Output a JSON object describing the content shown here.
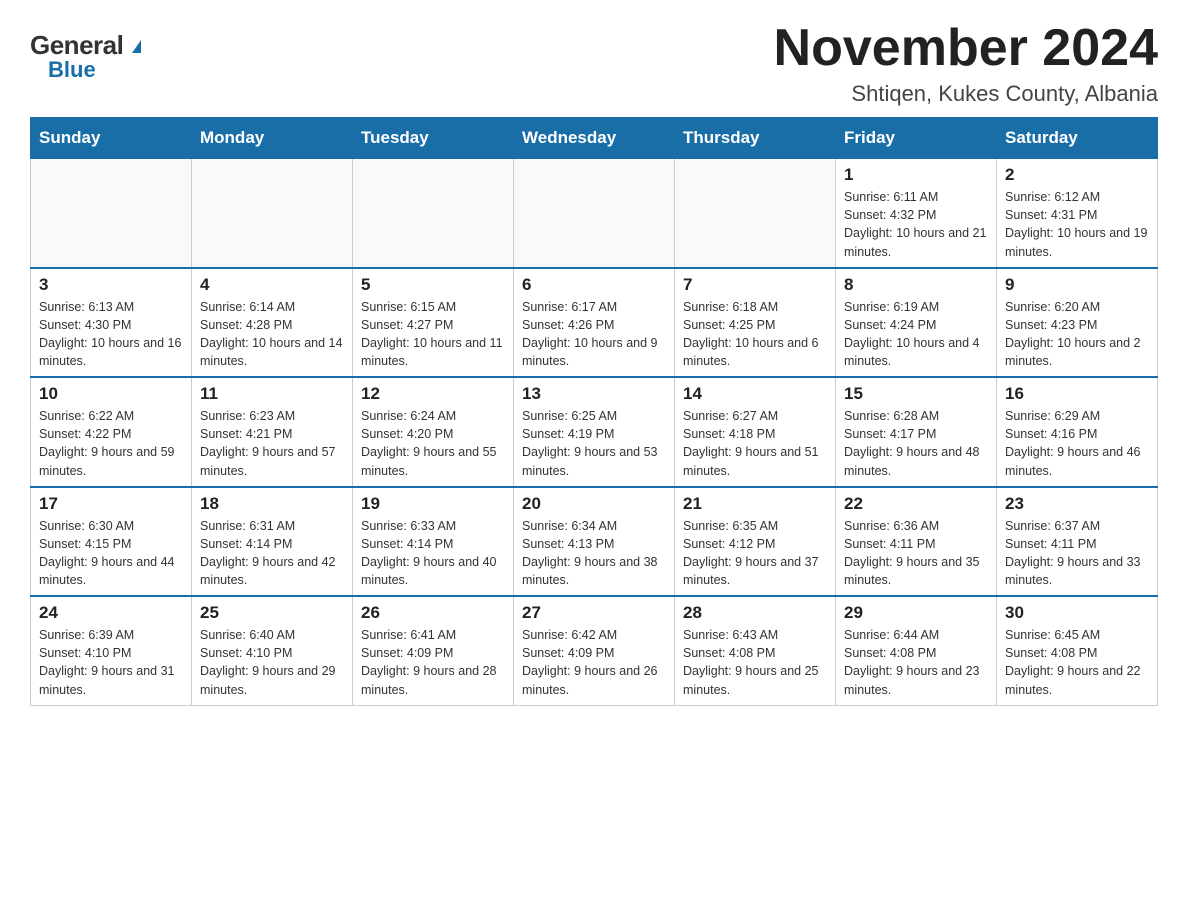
{
  "header": {
    "logo_general": "General",
    "logo_blue": "Blue",
    "title": "November 2024",
    "subtitle": "Shtiqen, Kukes County, Albania"
  },
  "weekdays": [
    "Sunday",
    "Monday",
    "Tuesday",
    "Wednesday",
    "Thursday",
    "Friday",
    "Saturday"
  ],
  "weeks": [
    [
      {
        "day": "",
        "sunrise": "",
        "sunset": "",
        "daylight": ""
      },
      {
        "day": "",
        "sunrise": "",
        "sunset": "",
        "daylight": ""
      },
      {
        "day": "",
        "sunrise": "",
        "sunset": "",
        "daylight": ""
      },
      {
        "day": "",
        "sunrise": "",
        "sunset": "",
        "daylight": ""
      },
      {
        "day": "",
        "sunrise": "",
        "sunset": "",
        "daylight": ""
      },
      {
        "day": "1",
        "sunrise": "Sunrise: 6:11 AM",
        "sunset": "Sunset: 4:32 PM",
        "daylight": "Daylight: 10 hours and 21 minutes."
      },
      {
        "day": "2",
        "sunrise": "Sunrise: 6:12 AM",
        "sunset": "Sunset: 4:31 PM",
        "daylight": "Daylight: 10 hours and 19 minutes."
      }
    ],
    [
      {
        "day": "3",
        "sunrise": "Sunrise: 6:13 AM",
        "sunset": "Sunset: 4:30 PM",
        "daylight": "Daylight: 10 hours and 16 minutes."
      },
      {
        "day": "4",
        "sunrise": "Sunrise: 6:14 AM",
        "sunset": "Sunset: 4:28 PM",
        "daylight": "Daylight: 10 hours and 14 minutes."
      },
      {
        "day": "5",
        "sunrise": "Sunrise: 6:15 AM",
        "sunset": "Sunset: 4:27 PM",
        "daylight": "Daylight: 10 hours and 11 minutes."
      },
      {
        "day": "6",
        "sunrise": "Sunrise: 6:17 AM",
        "sunset": "Sunset: 4:26 PM",
        "daylight": "Daylight: 10 hours and 9 minutes."
      },
      {
        "day": "7",
        "sunrise": "Sunrise: 6:18 AM",
        "sunset": "Sunset: 4:25 PM",
        "daylight": "Daylight: 10 hours and 6 minutes."
      },
      {
        "day": "8",
        "sunrise": "Sunrise: 6:19 AM",
        "sunset": "Sunset: 4:24 PM",
        "daylight": "Daylight: 10 hours and 4 minutes."
      },
      {
        "day": "9",
        "sunrise": "Sunrise: 6:20 AM",
        "sunset": "Sunset: 4:23 PM",
        "daylight": "Daylight: 10 hours and 2 minutes."
      }
    ],
    [
      {
        "day": "10",
        "sunrise": "Sunrise: 6:22 AM",
        "sunset": "Sunset: 4:22 PM",
        "daylight": "Daylight: 9 hours and 59 minutes."
      },
      {
        "day": "11",
        "sunrise": "Sunrise: 6:23 AM",
        "sunset": "Sunset: 4:21 PM",
        "daylight": "Daylight: 9 hours and 57 minutes."
      },
      {
        "day": "12",
        "sunrise": "Sunrise: 6:24 AM",
        "sunset": "Sunset: 4:20 PM",
        "daylight": "Daylight: 9 hours and 55 minutes."
      },
      {
        "day": "13",
        "sunrise": "Sunrise: 6:25 AM",
        "sunset": "Sunset: 4:19 PM",
        "daylight": "Daylight: 9 hours and 53 minutes."
      },
      {
        "day": "14",
        "sunrise": "Sunrise: 6:27 AM",
        "sunset": "Sunset: 4:18 PM",
        "daylight": "Daylight: 9 hours and 51 minutes."
      },
      {
        "day": "15",
        "sunrise": "Sunrise: 6:28 AM",
        "sunset": "Sunset: 4:17 PM",
        "daylight": "Daylight: 9 hours and 48 minutes."
      },
      {
        "day": "16",
        "sunrise": "Sunrise: 6:29 AM",
        "sunset": "Sunset: 4:16 PM",
        "daylight": "Daylight: 9 hours and 46 minutes."
      }
    ],
    [
      {
        "day": "17",
        "sunrise": "Sunrise: 6:30 AM",
        "sunset": "Sunset: 4:15 PM",
        "daylight": "Daylight: 9 hours and 44 minutes."
      },
      {
        "day": "18",
        "sunrise": "Sunrise: 6:31 AM",
        "sunset": "Sunset: 4:14 PM",
        "daylight": "Daylight: 9 hours and 42 minutes."
      },
      {
        "day": "19",
        "sunrise": "Sunrise: 6:33 AM",
        "sunset": "Sunset: 4:14 PM",
        "daylight": "Daylight: 9 hours and 40 minutes."
      },
      {
        "day": "20",
        "sunrise": "Sunrise: 6:34 AM",
        "sunset": "Sunset: 4:13 PM",
        "daylight": "Daylight: 9 hours and 38 minutes."
      },
      {
        "day": "21",
        "sunrise": "Sunrise: 6:35 AM",
        "sunset": "Sunset: 4:12 PM",
        "daylight": "Daylight: 9 hours and 37 minutes."
      },
      {
        "day": "22",
        "sunrise": "Sunrise: 6:36 AM",
        "sunset": "Sunset: 4:11 PM",
        "daylight": "Daylight: 9 hours and 35 minutes."
      },
      {
        "day": "23",
        "sunrise": "Sunrise: 6:37 AM",
        "sunset": "Sunset: 4:11 PM",
        "daylight": "Daylight: 9 hours and 33 minutes."
      }
    ],
    [
      {
        "day": "24",
        "sunrise": "Sunrise: 6:39 AM",
        "sunset": "Sunset: 4:10 PM",
        "daylight": "Daylight: 9 hours and 31 minutes."
      },
      {
        "day": "25",
        "sunrise": "Sunrise: 6:40 AM",
        "sunset": "Sunset: 4:10 PM",
        "daylight": "Daylight: 9 hours and 29 minutes."
      },
      {
        "day": "26",
        "sunrise": "Sunrise: 6:41 AM",
        "sunset": "Sunset: 4:09 PM",
        "daylight": "Daylight: 9 hours and 28 minutes."
      },
      {
        "day": "27",
        "sunrise": "Sunrise: 6:42 AM",
        "sunset": "Sunset: 4:09 PM",
        "daylight": "Daylight: 9 hours and 26 minutes."
      },
      {
        "day": "28",
        "sunrise": "Sunrise: 6:43 AM",
        "sunset": "Sunset: 4:08 PM",
        "daylight": "Daylight: 9 hours and 25 minutes."
      },
      {
        "day": "29",
        "sunrise": "Sunrise: 6:44 AM",
        "sunset": "Sunset: 4:08 PM",
        "daylight": "Daylight: 9 hours and 23 minutes."
      },
      {
        "day": "30",
        "sunrise": "Sunrise: 6:45 AM",
        "sunset": "Sunset: 4:08 PM",
        "daylight": "Daylight: 9 hours and 22 minutes."
      }
    ]
  ]
}
